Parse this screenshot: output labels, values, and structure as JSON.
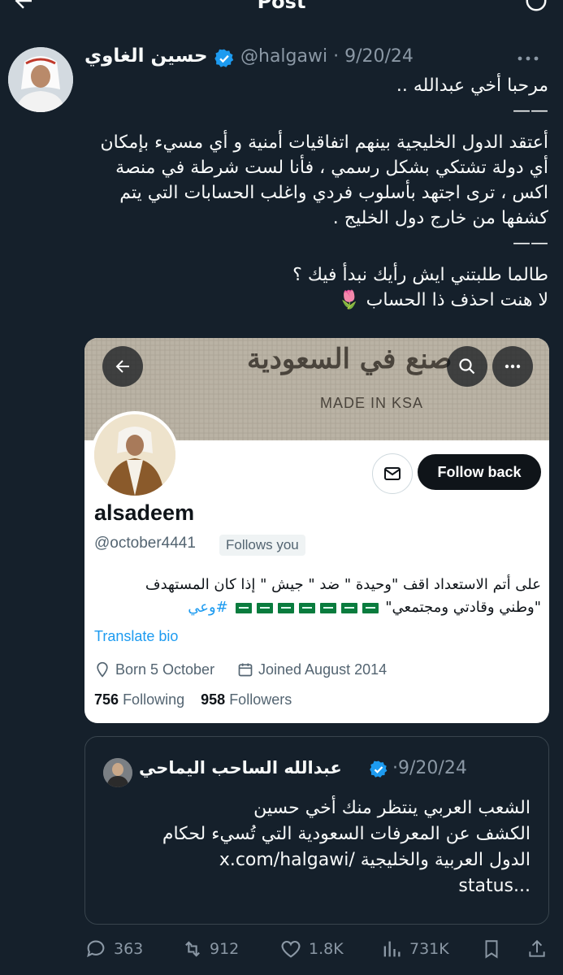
{
  "topbar": {
    "title": "Post"
  },
  "tweet": {
    "author_name": "حسين الغاوي",
    "handle": "@halgawi",
    "date": "9/20/24",
    "paragraphs": [
      "مرحبا أخي عبدالله ..\n——",
      "أعتقد الدول الخليجية بينهم اتفاقيات أمنية و أي مسيء بإمكان أي دولة تشتكي بشكل رسمي ، فأنا لست شرطة في منصة اكس ، ترى اجتهد بأسلوب فردي واغلب الحسابات التي يتم كشفها من خارج دول الخليج .\n——",
      "طالما طلبتني ايش رأيك نبدأ فيك ؟\nلا هنت احذف ذا الحساب 🌷"
    ]
  },
  "profile_card": {
    "banner_arabic": "صنع في السعودية",
    "banner_made": "MADE IN KSA",
    "follow_back_label": "Follow back",
    "name": "alsadeem",
    "handle": "@october4441",
    "follows_you": "Follows you",
    "bio_line1": "على أتم الاستعداد اقف \"وحيدة \" ضد \" جيش \" إذا كان المستهدف",
    "bio_line2_text": "\"وطني وقادتي ومجتمعي\"",
    "bio_hashtag": "#وعي",
    "translate": "Translate bio",
    "born": "Born 5 October",
    "joined": "Joined August 2014",
    "following_count": "756",
    "following_label": "Following",
    "followers_count": "958",
    "followers_label": "Followers"
  },
  "quote": {
    "author_name": "عبدالله الساحب اليماحي",
    "date": "9/20/24",
    "text": "الشعب العربي ينتظر منك أخي حسين\nالكشف عن المعرفات السعودية التي تُسيء لحكام\nالدول العربية والخليجية /x.com/halgawi\nstatus..."
  },
  "actions": {
    "replies": "363",
    "reposts": "912",
    "likes": "1.8K",
    "views": "731K"
  },
  "colors": {
    "background": "#15202b",
    "accent": "#1d9bf0",
    "muted": "#8b98a5"
  }
}
